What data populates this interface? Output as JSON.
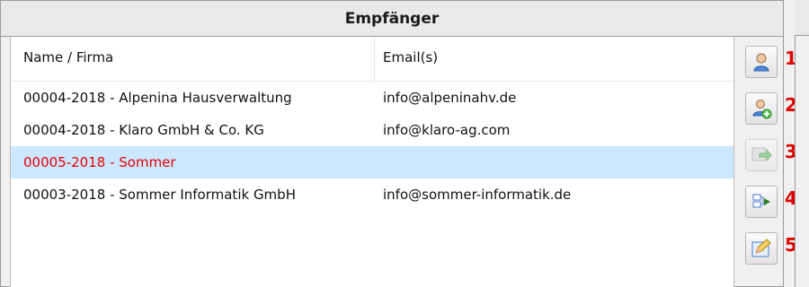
{
  "panel": {
    "title": "Empfänger"
  },
  "table": {
    "columns": {
      "name": "Name / Firma",
      "email": "Email(s)"
    },
    "rows": [
      {
        "name": "00004-2018 - Alpenina Hausverwaltung",
        "email": "info@alpeninahv.de"
      },
      {
        "name": "00004-2018 - Klaro GmbH & Co. KG",
        "email": "info@klaro-ag.com"
      },
      {
        "name": "00005-2018 - Sommer",
        "email": ""
      },
      {
        "name": "00003-2018 - Sommer Informatik GmbH",
        "email": "info@sommer-informatik.de"
      }
    ],
    "selected_index": 2
  },
  "toolbar": {
    "items": [
      {
        "number": "1",
        "icon": "user-icon"
      },
      {
        "number": "2",
        "icon": "add-user-icon"
      },
      {
        "number": "3",
        "icon": "forward-icon"
      },
      {
        "number": "4",
        "icon": "transfer-icon"
      },
      {
        "number": "5",
        "icon": "edit-icon"
      }
    ]
  },
  "colors": {
    "selected_bg": "#cce8ff",
    "selected_text": "#e60000",
    "number_red": "#e00000"
  }
}
